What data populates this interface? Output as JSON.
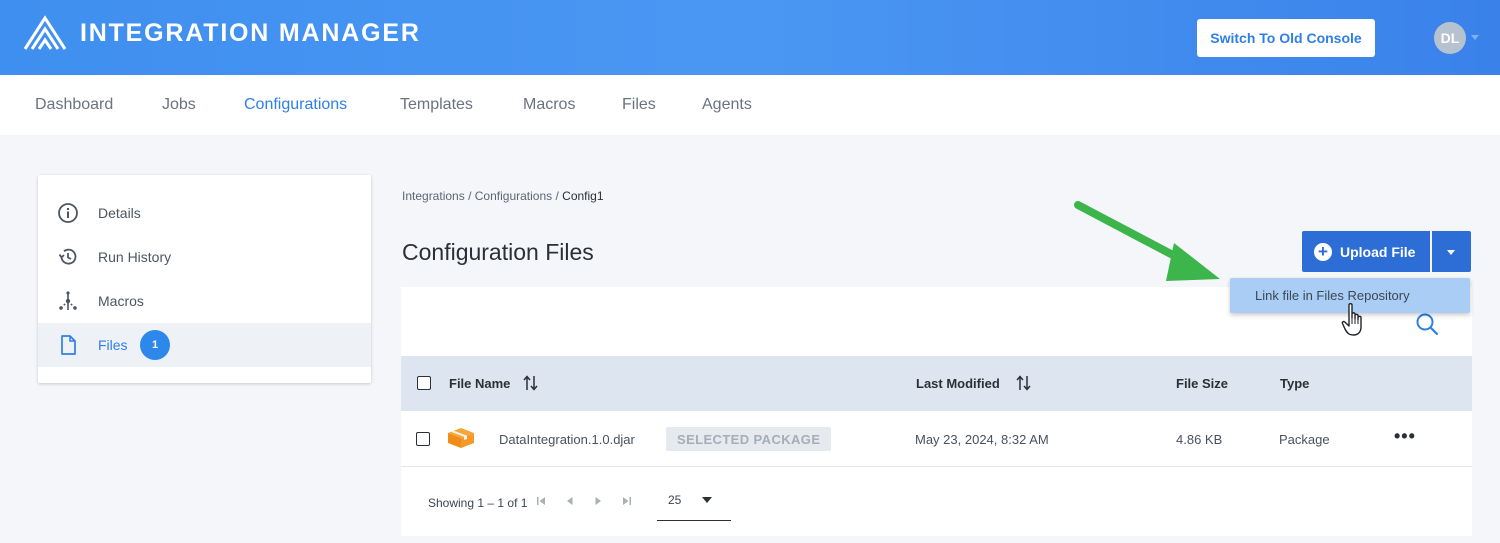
{
  "header": {
    "app_title": "INTEGRATION MANAGER",
    "switch_console_label": "Switch To Old Console",
    "avatar_initials": "DL",
    "brand_color": "#3f8ff0"
  },
  "nav": {
    "items": [
      "Dashboard",
      "Jobs",
      "Configurations",
      "Templates",
      "Macros",
      "Files",
      "Agents"
    ],
    "active": "Configurations"
  },
  "sidebar": {
    "items": [
      {
        "label": "Details",
        "icon": "info-icon"
      },
      {
        "label": "Run History",
        "icon": "history-icon"
      },
      {
        "label": "Macros",
        "icon": "macros-icon"
      },
      {
        "label": "Files",
        "icon": "file-icon",
        "badge": "1",
        "active": true
      }
    ]
  },
  "breadcrumb": {
    "items": [
      "Integrations",
      "Configurations"
    ],
    "separator": "/",
    "current": "Config1"
  },
  "main": {
    "title": "Configuration Files",
    "upload_label": "Upload File",
    "dropdown_item": "Link file in Files Repository"
  },
  "table": {
    "columns": [
      "File Name",
      "Last Modified",
      "File Size",
      "Type"
    ],
    "rows": [
      {
        "name": "DataIntegration.1.0.djar",
        "tag": "SELECTED PACKAGE",
        "modified": "May 23, 2024, 8:32 AM",
        "size": "4.86 KB",
        "type": "Package",
        "actions": "•••"
      }
    ]
  },
  "pager": {
    "showing": "Showing 1 – 1 of 1",
    "per_page": "25"
  },
  "colors": {
    "accent": "#2e7fe6",
    "primary_button": "#2d6ed6",
    "annotation_arrow": "#3cb54a"
  }
}
